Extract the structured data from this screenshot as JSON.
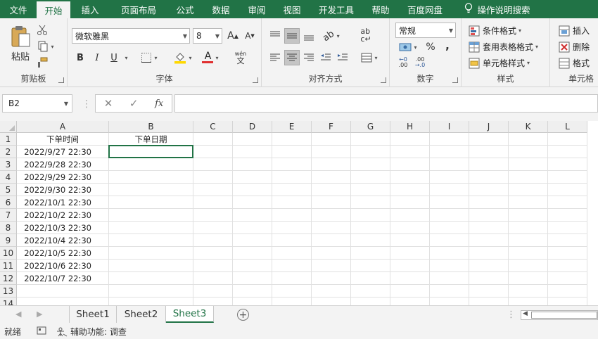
{
  "tabs": {
    "file": "文件",
    "home": "开始",
    "insert": "插入",
    "layout": "页面布局",
    "formulas": "公式",
    "data": "数据",
    "review": "审阅",
    "view": "视图",
    "developer": "开发工具",
    "help": "帮助",
    "baidu": "百度网盘",
    "tellme": "操作说明搜索"
  },
  "ribbon": {
    "clipboard": {
      "paste": "粘贴",
      "label": "剪贴板"
    },
    "font": {
      "name": "微软雅黑",
      "size": "8",
      "bold": "B",
      "italic": "I",
      "underline": "U",
      "phonetic": "wén",
      "phonetic2": "文",
      "label": "字体"
    },
    "alignment": {
      "label": "对齐方式"
    },
    "number": {
      "format": "常规",
      "percent": "%",
      "comma": ",",
      "label": "数字"
    },
    "styles": {
      "conditional": "条件格式",
      "table": "套用表格格式",
      "cell": "单元格样式",
      "label": "样式"
    },
    "cells": {
      "insert": "插入",
      "delete": "删除",
      "format": "格式",
      "label": "单元格"
    }
  },
  "formula_bar": {
    "name_box": "B2",
    "fx": "fx",
    "cancel": "✕",
    "enter": "✓",
    "value": ""
  },
  "columns": [
    "A",
    "B",
    "C",
    "D",
    "E",
    "F",
    "G",
    "H",
    "I",
    "J",
    "K",
    "L"
  ],
  "rows": [
    "1",
    "2",
    "3",
    "4",
    "5",
    "6",
    "7",
    "8",
    "9",
    "10",
    "11",
    "12",
    "13",
    "14"
  ],
  "cells": {
    "A1": "下单时间",
    "B1": "下单日期",
    "A": [
      "2022/9/27 22:30",
      "2022/9/28 22:30",
      "2022/9/29 22:30",
      "2022/9/30 22:30",
      "2022/10/1 22:30",
      "2022/10/2 22:30",
      "2022/10/3 22:30",
      "2022/10/4 22:30",
      "2022/10/5 22:30",
      "2022/10/6 22:30",
      "2022/10/7 22:30"
    ]
  },
  "sheets": [
    "Sheet1",
    "Sheet2",
    "Sheet3"
  ],
  "active_sheet": "Sheet3",
  "status": {
    "ready": "就绪",
    "accessibility": "辅助功能: 调查"
  },
  "colors": {
    "accent": "#217346"
  }
}
